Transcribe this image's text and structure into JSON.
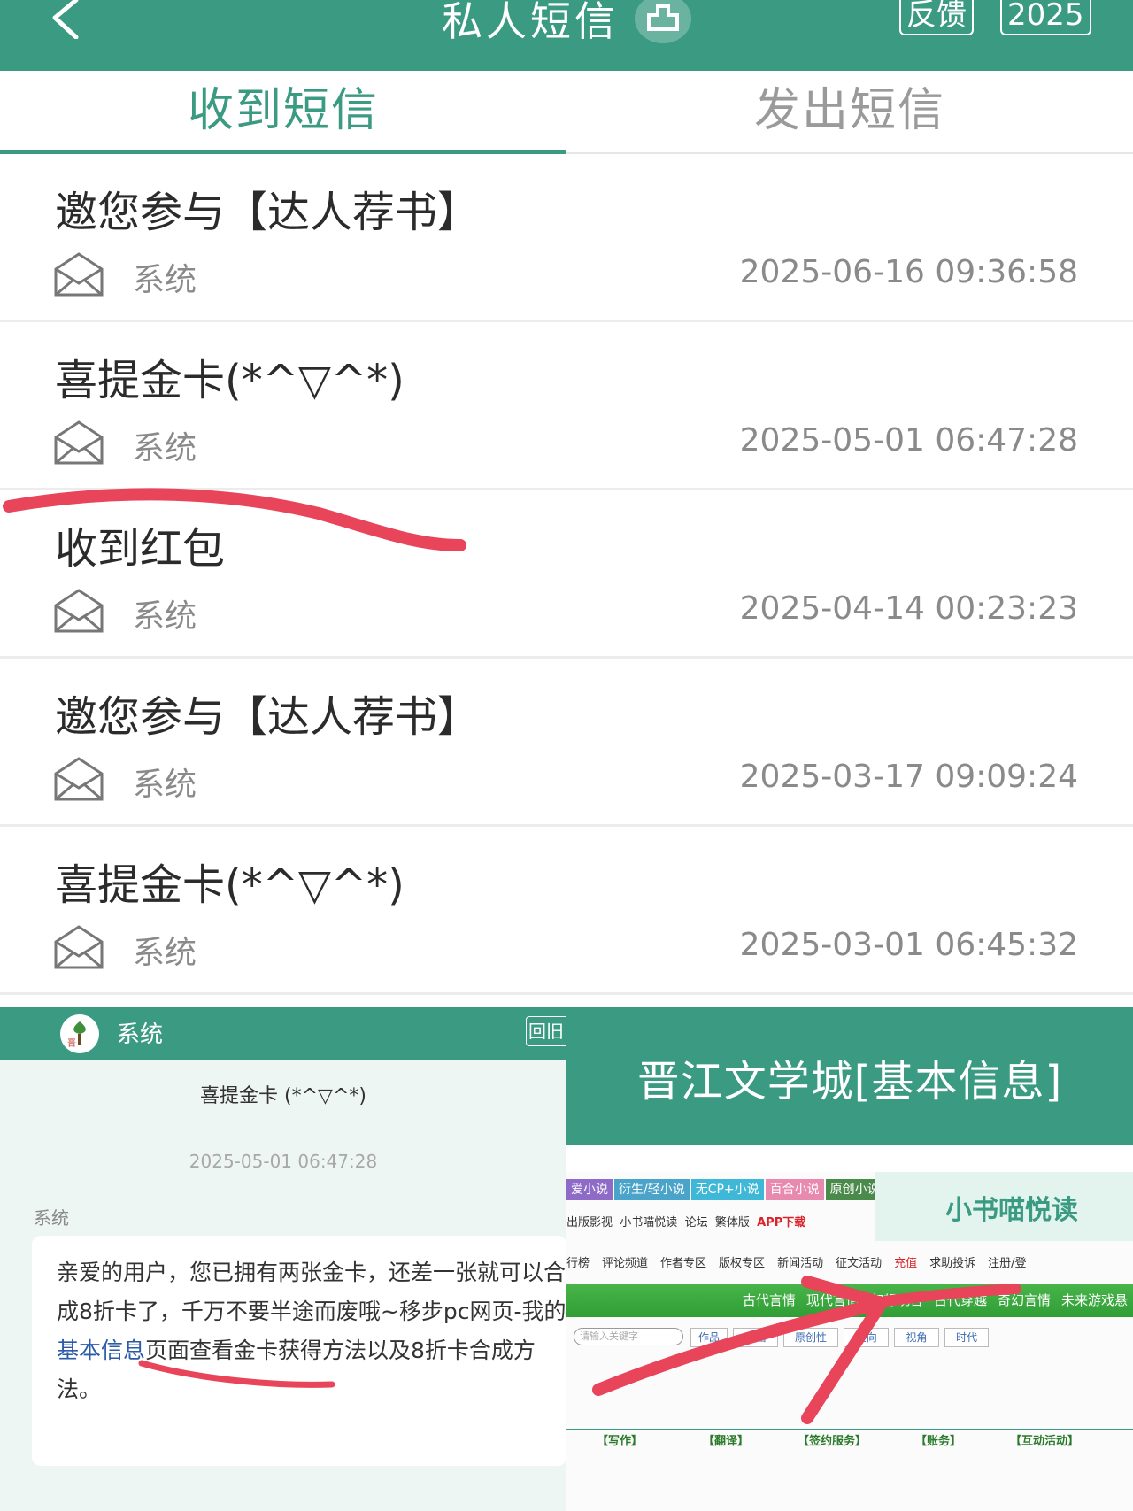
{
  "header": {
    "title": "私人短信",
    "feedback_label": "反馈",
    "year_label": "2025"
  },
  "tabs": [
    {
      "label": "收到短信",
      "active": true
    },
    {
      "label": "发出短信",
      "active": false
    }
  ],
  "messages": [
    {
      "title": "邀您参与【达人荐书】",
      "sender": "系统",
      "time": "2025-06-16 09:36:58"
    },
    {
      "title": "喜提金卡(*^▽^*)",
      "sender": "系统",
      "time": "2025-05-01 06:47:28"
    },
    {
      "title": "收到红包",
      "sender": "系统",
      "time": "2025-04-14 00:23:23"
    },
    {
      "title": "邀您参与【达人荐书】",
      "sender": "系统",
      "time": "2025-03-17 09:09:24"
    },
    {
      "title": "喜提金卡(*^▽^*)",
      "sender": "系统",
      "time": "2025-03-01 06:45:32"
    }
  ],
  "detail": {
    "bar_title": "系统",
    "reply_label": "回旧",
    "subject": "喜提金卡 (*^▽^*)",
    "time": "2025-05-01 06:47:28",
    "sender": "系统",
    "body_before_link": "亲爱的用户，您已拥有两张金卡，还差一张就可以合成8折卡了，千万不要半途而废哦~移步pc网页-我的",
    "body_link": "基本信息",
    "body_after_link": "页面查看金卡获得方法以及8折卡合成方法。"
  },
  "info_page": {
    "title": "晋江文学城[基本信息]",
    "tags": [
      "爱小说",
      "衍生/轻小说",
      "无CP+小说",
      "百合小说",
      "原创小说"
    ],
    "links_row": [
      "出版影视",
      "小书喵悦读",
      "论坛",
      "繁体版",
      "APP下载"
    ],
    "banner_text": "小书喵悦读",
    "nav": [
      "行榜",
      "评论频道",
      "作者专区",
      "版权专区",
      "新闻活动",
      "征文活动",
      "充值",
      "求助投诉",
      "注册/登"
    ],
    "green_bar": [
      "古代言情",
      "现代言情",
      "幻想现言",
      "古代穿越",
      "奇幻言情",
      "未来游戏悬"
    ],
    "search_placeholder": "请输入关键字",
    "filters": [
      "作品",
      "-范围-",
      "-原创性-",
      "-性向-",
      "-视角-",
      "-时代-"
    ],
    "sections": [
      "【写作】",
      "【翻译】",
      "【签约服务】",
      "【账务】",
      "【互动活动】"
    ]
  },
  "colors": {
    "accent": "#3a9a82",
    "annotation": "#e8445a",
    "link": "#2a5aa8"
  }
}
